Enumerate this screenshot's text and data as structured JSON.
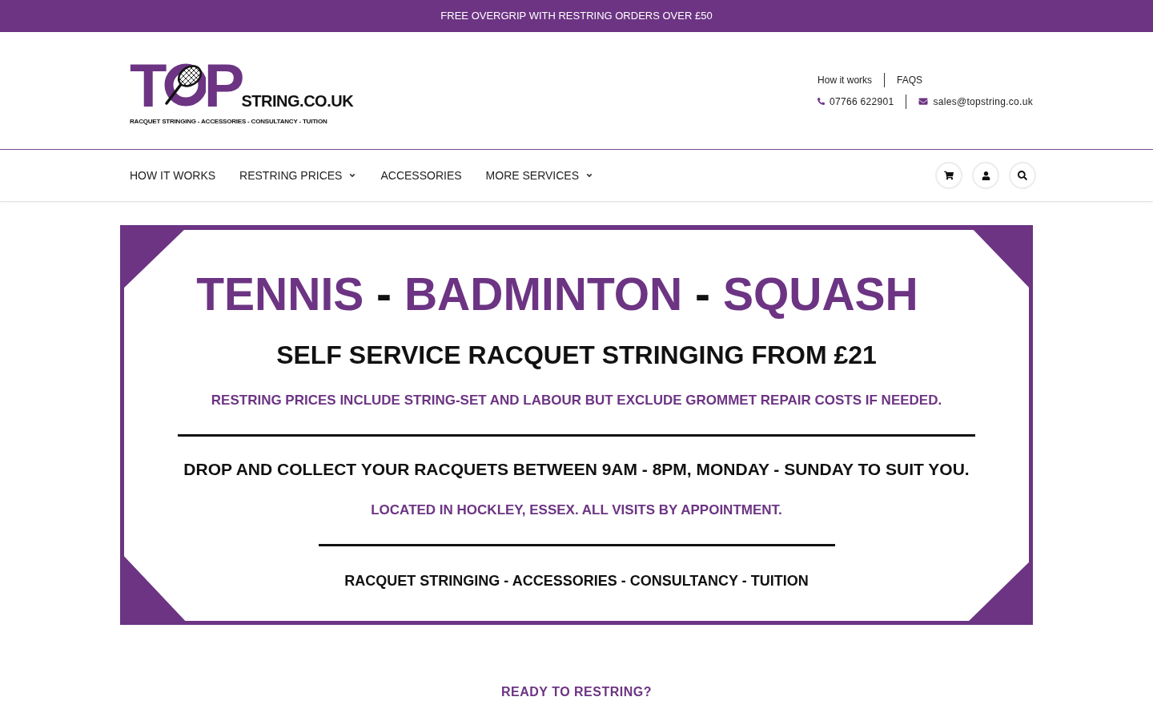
{
  "announcement_bar": {
    "text": "FREE OVERGRIP WITH RESTRING ORDERS OVER £50"
  },
  "header": {
    "logo": {
      "wordmark_start": "T",
      "wordmark_end": "P",
      "domain": "STRING.CO.UK",
      "tagline": "RACQUET STRINGING - ACCESSORIES - CONSULTANCY - TUITION"
    },
    "top_links": [
      "How it works",
      "FAQS"
    ],
    "contacts": [
      {
        "kind": "phone",
        "text": "07766 622901"
      },
      {
        "kind": "email",
        "text": "sales@topstring.co.uk"
      }
    ]
  },
  "nav": {
    "items": [
      {
        "label": "HOW IT WORKS",
        "has_dropdown": false
      },
      {
        "label": "RESTRING PRICES",
        "has_dropdown": true
      },
      {
        "label": "ACCESSORIES",
        "has_dropdown": false
      },
      {
        "label": "MORE SERVICES",
        "has_dropdown": true
      }
    ]
  },
  "hero_banner": {
    "title_segments": [
      {
        "kind": "sport",
        "text": "TENNIS"
      },
      {
        "kind": "separator",
        "text": "-"
      },
      {
        "kind": "sport",
        "text": "BADMINTON"
      },
      {
        "kind": "separator",
        "text": "-"
      },
      {
        "kind": "sport",
        "text": "SQUASH"
      }
    ],
    "lines": [
      {
        "kind": "headline",
        "text": "SELF SERVICE RACQUET STRINGING FROM £21"
      },
      {
        "kind": "note",
        "text": "RESTRING PRICES INCLUDE STRING-SET AND LABOUR BUT EXCLUDE GROMMET REPAIR COSTS IF NEEDED."
      },
      {
        "kind": "long_rule"
      },
      {
        "kind": "notice",
        "text": "DROP AND COLLECT YOUR RACQUETS BETWEEN 9AM - 8PM, MONDAY - SUNDAY TO SUIT YOU."
      },
      {
        "kind": "note",
        "text": "LOCATED IN HOCKLEY, ESSEX. ALL VISITS BY APPOINTMENT."
      },
      {
        "kind": "short_rule"
      },
      {
        "kind": "tagline",
        "text": "RACQUET STRINGING - ACCESSORIES - CONSULTANCY - TUITION"
      }
    ]
  },
  "section_heading": "READY TO RESTRING?"
}
